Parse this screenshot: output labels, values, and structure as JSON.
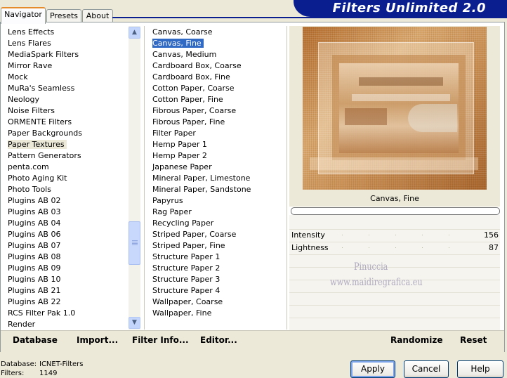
{
  "tabs": [
    {
      "label": "Navigator",
      "active": true
    },
    {
      "label": "Presets",
      "active": false
    },
    {
      "label": "About",
      "active": false
    }
  ],
  "app_title": "Filters Unlimited 2.0",
  "categories": [
    "Lens Effects",
    "Lens Flares",
    "MediaSpark Filters",
    "Mirror Rave",
    "Mock",
    "MuRa's Seamless",
    "Neology",
    "Noise Filters",
    "ORMENTE Filters",
    "Paper Backgrounds",
    "Paper Textures",
    "Pattern Generators",
    "penta.com",
    "Photo Aging Kit",
    "Photo Tools",
    "Plugins AB 02",
    "Plugins AB 03",
    "Plugins AB 04",
    "Plugins AB 06",
    "Plugins AB 07",
    "Plugins AB 08",
    "Plugins AB 09",
    "Plugins AB 10",
    "Plugins AB 21",
    "Plugins AB 22",
    "RCS Filter Pak 1.0",
    "Render"
  ],
  "selected_category": "Paper Textures",
  "filters": [
    "Canvas, Coarse",
    "Canvas, Fine",
    "Canvas, Medium",
    "Cardboard Box, Coarse",
    "Cardboard Box, Fine",
    "Cotton Paper, Coarse",
    "Cotton Paper, Fine",
    "Fibrous Paper, Coarse",
    "Fibrous Paper, Fine",
    "Filter Paper",
    "Hemp Paper 1",
    "Hemp Paper 2",
    "Japanese Paper",
    "Mineral Paper, Limestone",
    "Mineral Paper, Sandstone",
    "Papyrus",
    "Rag Paper",
    "Recycling Paper",
    "Striped Paper, Coarse",
    "Striped Paper, Fine",
    "Structure Paper 1",
    "Structure Paper 2",
    "Structure Paper 3",
    "Structure Paper 4",
    "Wallpaper, Coarse",
    "Wallpaper, Fine"
  ],
  "selected_filter": "Canvas, Fine",
  "preview": {
    "filter_name": "Canvas, Fine"
  },
  "params": [
    {
      "label": "Intensity",
      "value": "156"
    },
    {
      "label": "Lightness",
      "value": "87"
    }
  ],
  "watermark": {
    "line1": "Pinuccia",
    "line2": "www.maidiregrafica.eu"
  },
  "bottom_buttons": {
    "database": "Database",
    "import": "Import...",
    "filter_info": "Filter Info...",
    "editor": "Editor...",
    "randomize": "Randomize",
    "reset": "Reset"
  },
  "info": {
    "database_label": "Database:",
    "database_value": "ICNET-Filters",
    "filters_label": "Filters:",
    "filters_value": "1149"
  },
  "dialog_buttons": {
    "apply": "Apply",
    "cancel": "Cancel",
    "help": "Help"
  },
  "colors": {
    "selection": "#316AC5",
    "banner": "#0A1E8F",
    "face": "#ECE9D8"
  }
}
